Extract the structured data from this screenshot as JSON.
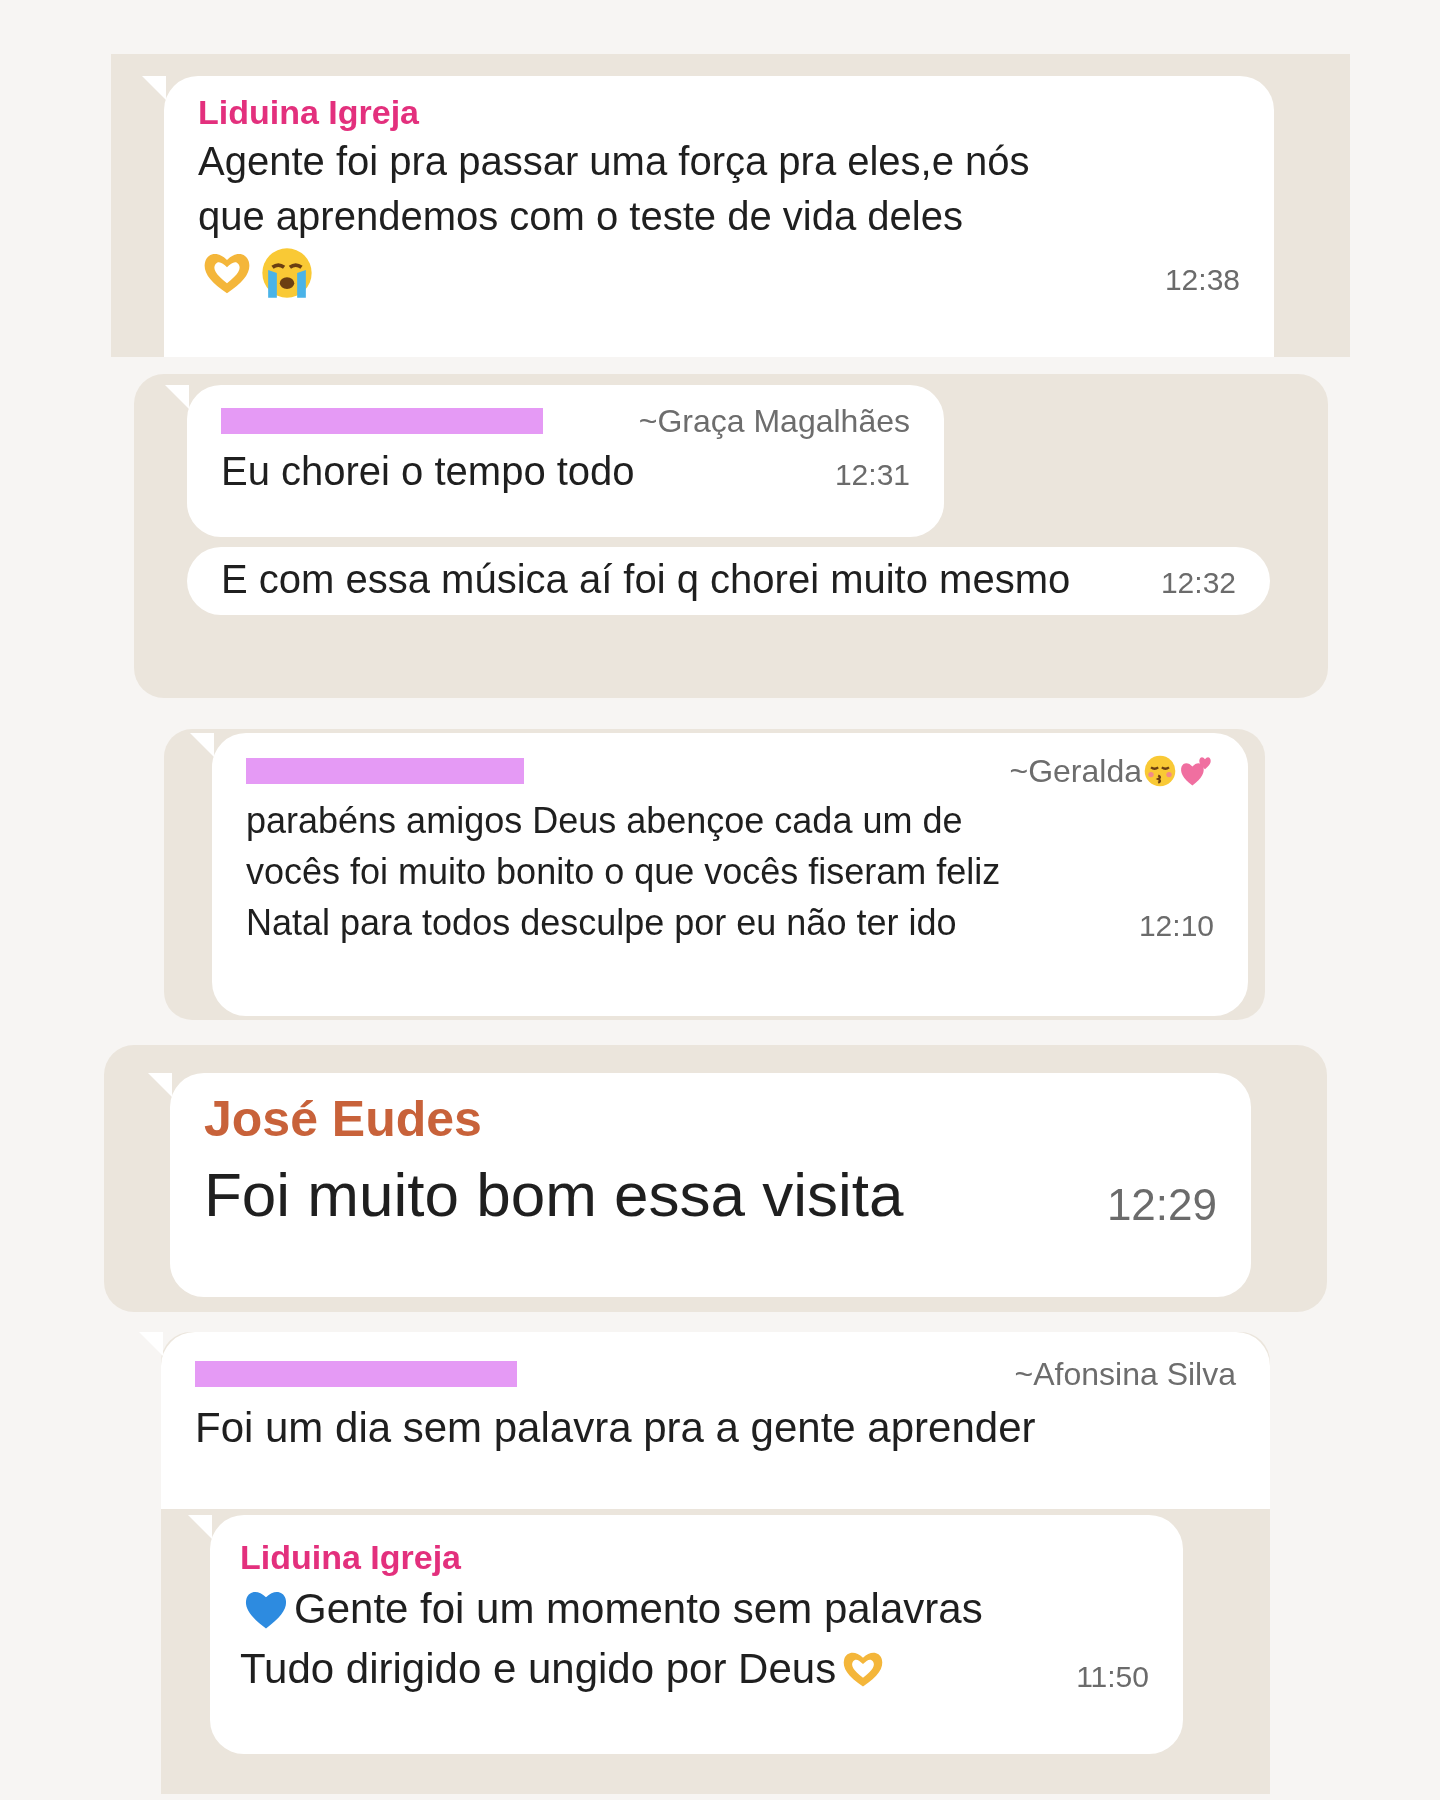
{
  "panels": [
    {
      "messages": [
        {
          "sender": "Liduina Igreja",
          "color": "#e3307d",
          "lines": [
            "Agente foi pra passar uma força pra eles,e nós",
            "que aprendemos com o teste de vida deles"
          ],
          "time": "12:38"
        }
      ]
    },
    {
      "messages": [
        {
          "redacted": true,
          "pushname": "~Graça Magalhães",
          "lines": [
            "Eu chorei o tempo todo"
          ],
          "time": "12:31"
        },
        {
          "lines": [
            "E com essa música aí foi q chorei muito mesmo"
          ],
          "time": "12:32"
        }
      ]
    },
    {
      "messages": [
        {
          "redacted": true,
          "pushname": "~Geralda",
          "lines": [
            "parabéns amigos Deus abençoe cada um de",
            "vocês foi muito bonito o que vocês fiseram feliz",
            "Natal para todos desculpe por eu não ter ido"
          ],
          "time": "12:10"
        }
      ]
    },
    {
      "messages": [
        {
          "sender": "José Eudes",
          "color": "#c8623a",
          "lines": [
            "Foi muito bom essa visita"
          ],
          "time": "12:29"
        }
      ]
    },
    {
      "messages": [
        {
          "redacted": true,
          "pushname": "~Afonsina Silva",
          "lines": [
            "Foi um dia sem palavra pra a gente aprender"
          ]
        },
        {
          "sender": "Liduina Igreja",
          "color": "#e3307d",
          "lines": [
            "Gente foi um momento sem palavras",
            "Tudo dirigido e ungido por Deus"
          ],
          "time": "11:50"
        }
      ]
    }
  ]
}
